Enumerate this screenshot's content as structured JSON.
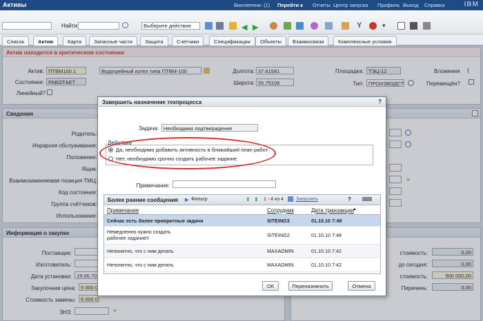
{
  "app": {
    "title": "Активы",
    "bulletins": "Бюллетени: (1)",
    "goto": "Перейти к",
    "reports": "Отчеты",
    "start_center": "Центр запуска",
    "profile": "Профиль",
    "logout": "Выход",
    "help": "Справка",
    "logo": "IBM"
  },
  "toolbar": {
    "find_label": "Найти:",
    "action_select": "Выберите действие"
  },
  "tabs": [
    "Список",
    "Актив",
    "Карта",
    "Запасные части",
    "Защита",
    "Счетчики",
    "Спецификации",
    "Объекты",
    "Взаимосвязи",
    "Комплексные условия"
  ],
  "alert": "Актив находится в критическом состоянии",
  "asset": {
    "asset_label": "Актив:",
    "asset_value": "ПТВМ100.1",
    "description": "Водогрейный котел типа ПТВМ-100",
    "state_label": "Состояние:",
    "state_value": "РАБОТАЕТ",
    "linear_label": "Линейный?",
    "longitude_label": "Долгота:",
    "longitude_value": "37.61581",
    "latitude_label": "Широта:",
    "latitude_value": "55.75108",
    "site_label": "Площадка:",
    "site_value": "ТЭЦ-12",
    "type_label": "Тип:",
    "type_value": "ПРОИЗВОДСТВ",
    "attachments_label": "Вложения",
    "moved_label": "Перемещён?"
  },
  "details": {
    "header": "Сведения",
    "parent": "Родитель:",
    "hierarchy": "Иерархия обслуживания:",
    "location": "Положение:",
    "bin": "Ящик:",
    "interchangeable": "Взаимозаменяемая позиция ТМЦ:",
    "condition_code": "Код состояния:",
    "meter_group": "Группа счётчиков:",
    "usage": "Использование:"
  },
  "purchase": {
    "header": "Информация о закупке",
    "vendor": "Поставщик:",
    "manufacturer": "Изготовитель:",
    "install_date_label": "Дата установки:",
    "install_date_value": "19.06.70",
    "purchase_price_label": "Закупочная цена:",
    "purchase_price_value": "5 000 0",
    "replace_cost_label": "Стоимость замены:",
    "replace_cost_value": "6 000 0",
    "znz_label": "ЗНЗ:"
  },
  "costs": {
    "cost_label": "стоимость:",
    "cost_value": "0,00",
    "ytd_label": "до сегодня:",
    "ytd_value": "0,00",
    "cost2_label": "стоимость:",
    "cost2_value": "500 000,00",
    "transfers_label": "Перечень:",
    "transfers_value": "0,00"
  },
  "dialog": {
    "title": "Завершить назначение техпроцесса",
    "help": "?",
    "task_label": "Задача:",
    "task_value": "Необходимо подтверждение",
    "action_header": "Действие",
    "option1": "Да, необходимо добавить активность в ближайший план работ",
    "option2": "Нет, необходимо срочно создать рабочее задание",
    "memo_label": "Примечание:",
    "memo_value": "",
    "grid": {
      "title": "Более ранние сообщения",
      "filter": "Фильтр",
      "pager": "1 - 4 из 4",
      "download": "Загрузить",
      "columns": [
        "Примечание",
        "Сотрудник",
        "Дата транзакции"
      ],
      "rows": [
        [
          "Сейчас есть более приоритные задачи",
          "SITEING3",
          "01.10.10 7:49"
        ],
        [
          "Немедленно нужно создать рабочее задание!!",
          "SITEING2",
          "01.10.10 7:48"
        ],
        [
          "Непонятно, что с ним делать",
          "MAXADMIN",
          "01.10.10 7:42"
        ],
        [
          "Непонятно, что с ним делать",
          "MAXADMIN",
          "01.10.10 7:42"
        ]
      ]
    },
    "ok": "ОК",
    "reassign": "Переназначить",
    "cancel": "Отмена"
  },
  "colors": {
    "highlight": "#c0392b",
    "header_blue": "#1f4b84",
    "selected_row": "#c5d6ee"
  }
}
